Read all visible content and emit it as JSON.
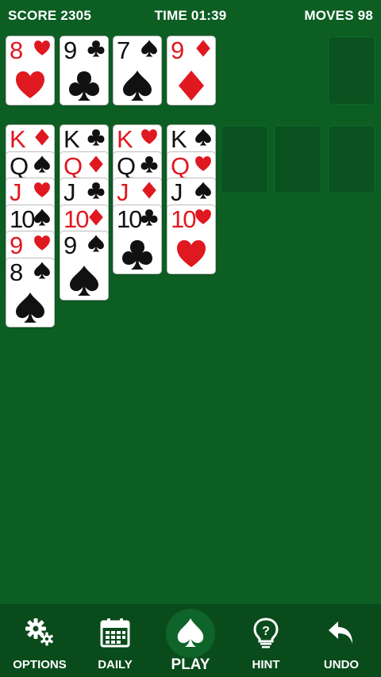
{
  "hud": {
    "score": "SCORE 2305",
    "time": "TIME 01:39",
    "moves": "MOVES 98"
  },
  "colors": {
    "felt": "#0c5e23",
    "bar": "#0a4b1c",
    "red": "#e01820",
    "black": "#111111"
  },
  "top_row": [
    {
      "rank": "8",
      "suit": "hearts"
    },
    {
      "rank": "9",
      "suit": "clubs"
    },
    {
      "rank": "7",
      "suit": "spades"
    },
    {
      "rank": "9",
      "suit": "diamonds"
    }
  ],
  "tableau": [
    [
      {
        "rank": "K",
        "suit": "diamonds"
      },
      {
        "rank": "Q",
        "suit": "spades"
      },
      {
        "rank": "J",
        "suit": "hearts"
      },
      {
        "rank": "10",
        "suit": "spades"
      },
      {
        "rank": "9",
        "suit": "hearts"
      },
      {
        "rank": "8",
        "suit": "spades"
      }
    ],
    [
      {
        "rank": "K",
        "suit": "clubs"
      },
      {
        "rank": "Q",
        "suit": "diamonds"
      },
      {
        "rank": "J",
        "suit": "clubs"
      },
      {
        "rank": "10",
        "suit": "diamonds"
      },
      {
        "rank": "9",
        "suit": "spades"
      }
    ],
    [
      {
        "rank": "K",
        "suit": "hearts"
      },
      {
        "rank": "Q",
        "suit": "clubs"
      },
      {
        "rank": "J",
        "suit": "diamonds"
      },
      {
        "rank": "10",
        "suit": "clubs"
      }
    ],
    [
      {
        "rank": "K",
        "suit": "spades"
      },
      {
        "rank": "Q",
        "suit": "hearts"
      },
      {
        "rank": "J",
        "suit": "spades"
      },
      {
        "rank": "10",
        "suit": "hearts"
      }
    ]
  ],
  "bottom_bar": {
    "options": {
      "label": "OPTIONS",
      "icon": "gears-icon"
    },
    "daily": {
      "label": "DAILY",
      "icon": "calendar-icon"
    },
    "play": {
      "label": "PLAY",
      "icon": "spade-icon"
    },
    "hint": {
      "label": "HINT",
      "icon": "lightbulb-question-icon"
    },
    "undo": {
      "label": "UNDO",
      "icon": "undo-arrow-icon"
    }
  }
}
